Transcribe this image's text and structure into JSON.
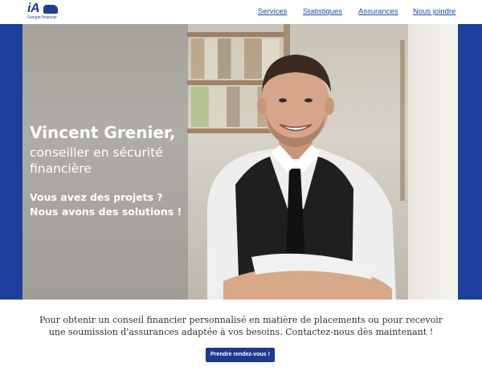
{
  "logo": {
    "brand": "iA",
    "tagline": "Groupe financier"
  },
  "nav": {
    "items": [
      {
        "label": "Services"
      },
      {
        "label": "Statistiques"
      },
      {
        "label": "Assurances"
      },
      {
        "label": "Nous joindre"
      }
    ]
  },
  "hero": {
    "name": "Vincent Grenier,",
    "role": "conseiller en sécurité financière",
    "tagline_line1": "Vous avez des projets ?",
    "tagline_line2": "Nous avons des solutions !"
  },
  "intro": {
    "text": "Pour obtenir un conseil financier personnalisé en matière de placements ou pour recevoir une soumission d'assurances adaptée à vos besoins. Contactez-nous dès maintenant !"
  },
  "cta": {
    "label": "Prendre rendez-vous !"
  },
  "colors": {
    "brand_blue": "#1d3f8f",
    "link_blue": "#1f49a8",
    "button_blue": "#1d3a8c",
    "hero_frame": "#1b3f9a"
  }
}
